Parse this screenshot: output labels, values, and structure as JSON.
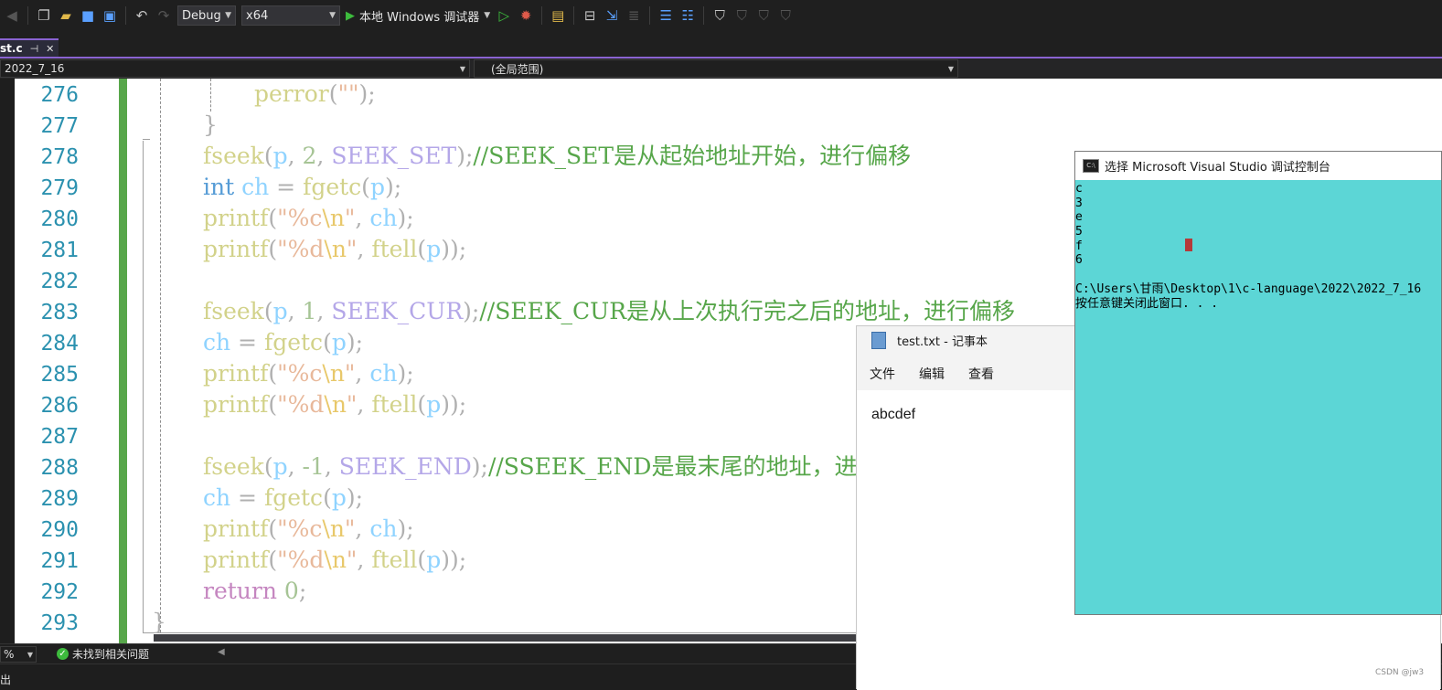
{
  "toolbar": {
    "config_select": "Debug",
    "platform_select": "x64",
    "run_label": "本地 Windows 调试器",
    "icons": [
      "back-icon",
      "new-project-icon",
      "open-file-icon",
      "save-icon",
      "save-all-icon",
      "undo-icon",
      "redo-icon",
      "play-icon",
      "start-without-debug-icon",
      "hot-reload-icon",
      "solution-explorer-icon",
      "browser-link-icon",
      "step-icon",
      "format-icon",
      "indent-icon",
      "comment-icon",
      "bookmark-icon",
      "bookmark-prev-icon",
      "bookmark-next-icon",
      "bookmark-clear-icon"
    ]
  },
  "tab": {
    "label": "st.c",
    "pin": "⊣",
    "close": "✕"
  },
  "navbar": {
    "project": "2022_7_16",
    "scope": "(全局范围)"
  },
  "editor": {
    "line_numbers": [
      "276",
      "277",
      "278",
      "279",
      "280",
      "281",
      "282",
      "283",
      "284",
      "285",
      "286",
      "287",
      "288",
      "289",
      "290",
      "291",
      "292",
      "293"
    ]
  },
  "code": {
    "l276": {
      "fn": "perror",
      "p1": "(",
      "str": "\"\"",
      "p2": ");"
    },
    "l277": {
      "brace": "}"
    },
    "l278": {
      "fn": "fseek",
      "p1": "(",
      "var": "p",
      "p2": ", ",
      "num": "2",
      "p3": ", ",
      "mac": "SEEK_SET",
      "p4": ");",
      "cmt": "//SEEK_SET是从起始地址开始，进行偏移"
    },
    "l279": {
      "kw": "int",
      "sp": " ",
      "var": "ch",
      "p1": " = ",
      "fn": "fgetc",
      "p2": "(",
      "var2": "p",
      "p3": ");"
    },
    "l280": {
      "fn": "printf",
      "p1": "(",
      "s1": "\"%c",
      "esc": "\\n",
      "s2": "\"",
      "p2": ", ",
      "var": "ch",
      "p3": ");"
    },
    "l281": {
      "fn": "printf",
      "p1": "(",
      "s1": "\"%d",
      "esc": "\\n",
      "s2": "\"",
      "p2": ", ",
      "fn2": "ftell",
      "p3": "(",
      "var": "p",
      "p4": "));"
    },
    "l283": {
      "fn": "fseek",
      "p1": "(",
      "var": "p",
      "p2": ", ",
      "num": "1",
      "p3": ", ",
      "mac": "SEEK_CUR",
      "p4": ");",
      "cmt": "//SEEK_CUR是从上次执行完之后的地址，进行偏移"
    },
    "l284": {
      "var": "ch",
      "p1": " = ",
      "fn": "fgetc",
      "p2": "(",
      "var2": "p",
      "p3": ");"
    },
    "l285": {
      "fn": "printf",
      "p1": "(",
      "s1": "\"%c",
      "esc": "\\n",
      "s2": "\"",
      "p2": ", ",
      "var": "ch",
      "p3": ");"
    },
    "l286": {
      "fn": "printf",
      "p1": "(",
      "s1": "\"%d",
      "esc": "\\n",
      "s2": "\"",
      "p2": ", ",
      "fn2": "ftell",
      "p3": "(",
      "var": "p",
      "p4": "));"
    },
    "l288": {
      "fn": "fseek",
      "p1": "(",
      "var": "p",
      "p2": ", ",
      "num": "-1",
      "p3": ", ",
      "mac": "SEEK_END",
      "p4": ");",
      "cmt": "//SSEEK_END是最末尾的地址，进"
    },
    "l289": {
      "var": "ch",
      "p1": " = ",
      "fn": "fgetc",
      "p2": "(",
      "var2": "p",
      "p3": ");"
    },
    "l290": {
      "fn": "printf",
      "p1": "(",
      "s1": "\"%c",
      "esc": "\\n",
      "s2": "\"",
      "p2": ", ",
      "var": "ch",
      "p3": ");"
    },
    "l291": {
      "fn": "printf",
      "p1": "(",
      "s1": "\"%d",
      "esc": "\\n",
      "s2": "\"",
      "p2": ", ",
      "fn2": "ftell",
      "p3": "(",
      "var": "p",
      "p4": "));"
    },
    "l292": {
      "kw": "return",
      "sp": " ",
      "num": "0",
      "p1": ";"
    },
    "l293": {
      "brace": "}"
    }
  },
  "statusbar": {
    "zoom": "%",
    "status": "未找到相关问题"
  },
  "bottom": {
    "label": "出"
  },
  "notepad": {
    "title": "test.txt - 记事本",
    "menu": [
      "文件",
      "编辑",
      "查看"
    ],
    "content": "abcdef"
  },
  "console": {
    "title": "选择 Microsoft Visual Studio 调试控制台",
    "icon_text": "C:\\",
    "lines": [
      "c",
      "3",
      "e",
      "5",
      "f",
      "6",
      "",
      "C:\\Users\\甘雨\\Desktop\\1\\c-language\\2022\\2022_7_16",
      "按任意键关闭此窗口. . ."
    ]
  },
  "watermark": "CSDN @jw3",
  "colors": {
    "accent": "#8a63d2",
    "console_bg": "#5cd6d6",
    "change_bar": "#57a64a"
  }
}
